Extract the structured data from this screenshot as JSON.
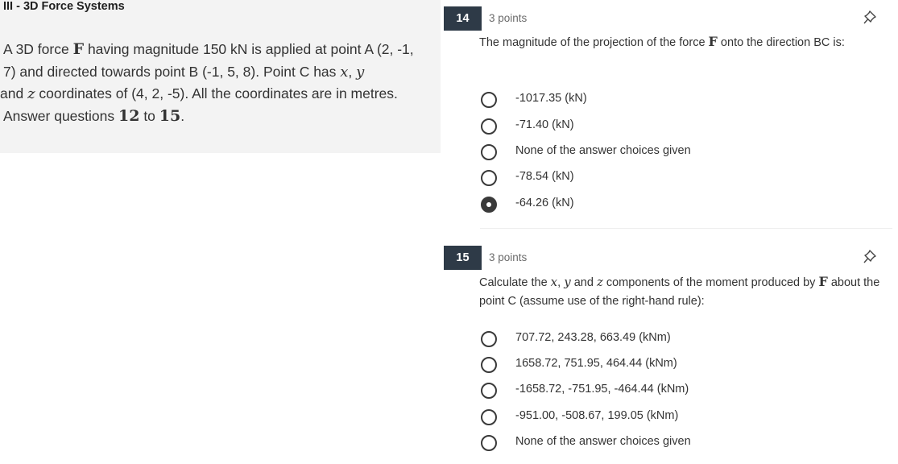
{
  "section": {
    "title": "III - 3D Force Systems"
  },
  "context": {
    "p1": "A 3D force ",
    "F": "F",
    "p2": " having magnitude 150 kN is applied at point A (2, -1, 7) and directed towards point B (-1, 5, 8). Point C has ",
    "x": "x",
    "comma1": ", ",
    "y": "y",
    "and": " and ",
    "z": "z",
    "p3": " coordinates of (4, 2, -5). All the coordinates are in metres. Answer questions ",
    "n12": "12",
    "to": " to ",
    "n15": "15",
    "end": "."
  },
  "questions": [
    {
      "number": "14",
      "points": "3 points",
      "text_a": "The magnitude of the projection of the force ",
      "F": "F",
      "text_b": " onto the direction BC is:",
      "options": [
        {
          "label": "-1017.35 (kN)",
          "selected": false
        },
        {
          "label": "-71.40 (kN)",
          "selected": false
        },
        {
          "label": "None of the answer choices given",
          "selected": false
        },
        {
          "label": "-78.54 (kN)",
          "selected": false
        },
        {
          "label": "-64.26 (kN)",
          "selected": true
        }
      ]
    },
    {
      "number": "15",
      "points": "3 points",
      "text_a": "Calculate the ",
      "x": "x",
      "comma1": ", ",
      "y": "y",
      "and": " and ",
      "z": "z",
      "text_b": " components of the moment produced by ",
      "F": "F",
      "text_c": " about the point C (assume use of the right-hand rule):",
      "options": [
        {
          "label": "707.72, 243.28, 663.49 (kNm)",
          "selected": false
        },
        {
          "label": "1658.72, 751.95, 464.44 (kNm)",
          "selected": false
        },
        {
          "label": "-1658.72, -751.95, -464.44 (kNm)",
          "selected": false
        },
        {
          "label": "-951.00, -508.67, 199.05 (kNm)",
          "selected": false
        },
        {
          "label": "None of the answer choices given",
          "selected": false
        }
      ]
    }
  ],
  "icons": {
    "pin": "pin-icon",
    "radio": "radio-button"
  },
  "colors": {
    "badge_bg": "#2e3a47",
    "panel_bg": "#f3f3f3",
    "text": "#333333",
    "points": "#6b6b6b"
  }
}
